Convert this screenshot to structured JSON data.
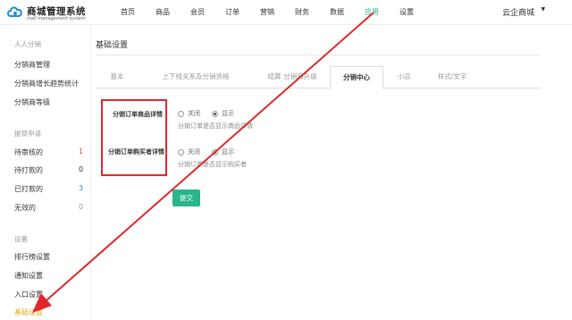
{
  "header": {
    "logo_title": "商城管理系统",
    "logo_subtitle": "mall management system",
    "nav": [
      "首页",
      "商品",
      "会员",
      "订单",
      "营销",
      "财务",
      "数据",
      "应用",
      "设置"
    ],
    "active_nav": "应用",
    "shop_name": "云企商城",
    "shop_caret": "▼"
  },
  "sidebar": {
    "sec1_heading": "人人分销",
    "manage": "分销商管理",
    "trend": "分销商增长趋势统计",
    "level": "分销商等级",
    "sec2_heading": "提现申请",
    "pending": {
      "label": "待审核的",
      "count": "1"
    },
    "unpaid": {
      "label": "待打款的",
      "count": "0"
    },
    "paid": {
      "label": "已打款的",
      "count": "3"
    },
    "invalid": {
      "label": "无效的",
      "count": "0"
    },
    "sec3_heading": "设置",
    "ranking": "排行榜设置",
    "notify": "通知设置",
    "entry": "入口设置",
    "basic": "基础设置"
  },
  "main": {
    "title": "基础设置",
    "tabs": {
      "basic": "基本",
      "relation": "上下线关系及分销资格",
      "settle": "结算",
      "upgrade": "分销商升级",
      "center": "分销中心",
      "shop": "小店",
      "style": "样式/文字"
    },
    "active_tab": "分销中心",
    "fields": {
      "goods": {
        "label": "分销订单商品详情",
        "off": "关闭",
        "on": "显示",
        "help": "分销订单是否显示商品详情"
      },
      "buyer": {
        "label": "分销订单购买者详情",
        "off": "关闭",
        "on": "显示",
        "help": "分销订单是否显示购买者"
      }
    },
    "submit": "提交"
  },
  "colors": {
    "accent_green": "#29b58c",
    "highlight_red": "#e0282c",
    "sidebar_active": "#e8a91a"
  }
}
